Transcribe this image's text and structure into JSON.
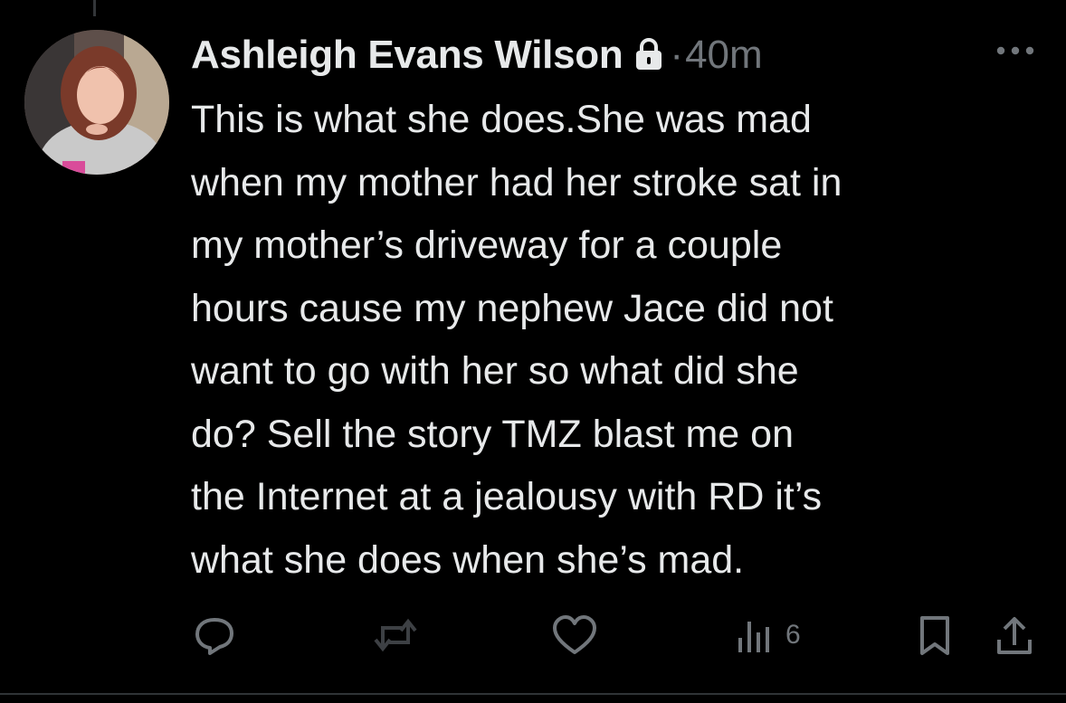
{
  "tweet": {
    "author_name": "Ashleigh Evans Wilson",
    "separator": "·",
    "timestamp": "40m",
    "text": "This is what she does.She was mad\nwhen my mother had her stroke sat in\nmy mother’s driveway for a couple\nhours cause my nephew Jace did not\nwant to go with her so what did she\ndo? Sell the story TMZ blast me on\nthe Internet at a jealousy with RD it’s\nwhat she does when she’s mad."
  },
  "actions": {
    "views_count": "6"
  },
  "icons": {
    "lock": "lock-icon",
    "more": "more-horizontal-icon",
    "reply": "reply-icon",
    "retweet": "retweet-icon",
    "like": "heart-icon",
    "views": "views-bar-chart-icon",
    "bookmark": "bookmark-icon",
    "share": "share-icon"
  },
  "colors": {
    "background": "#000000",
    "primary_text": "#e7e9ea",
    "secondary_text": "#71767b",
    "retweet_icon_muted": "#3d4044"
  }
}
